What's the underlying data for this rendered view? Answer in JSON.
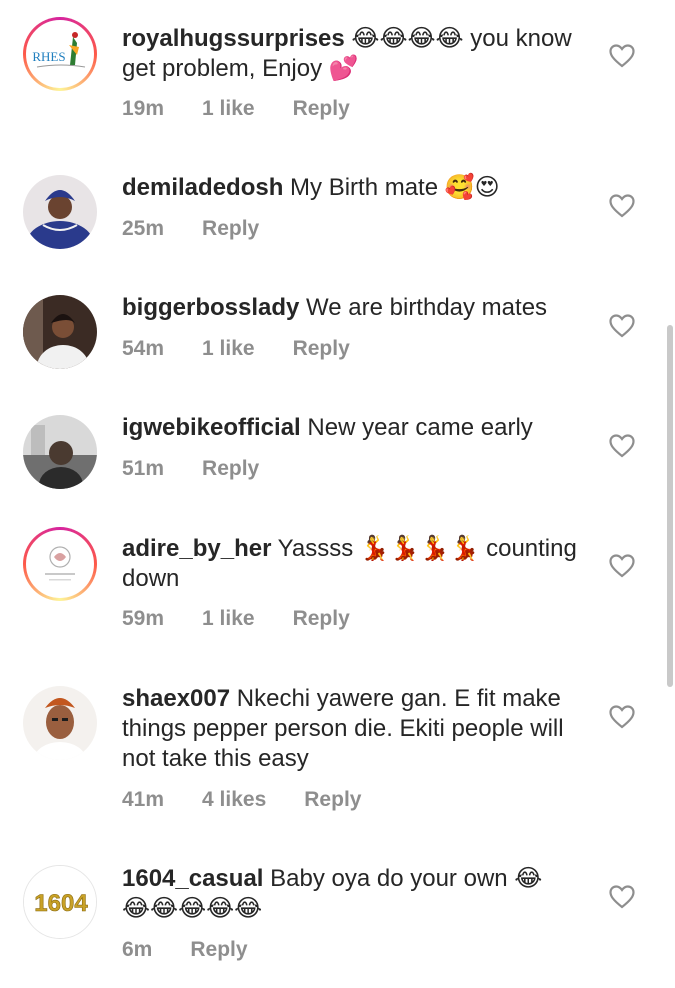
{
  "comments": [
    {
      "username": "royalhugssurprises",
      "text": " 😂😂😂😂 you know get problem, Enjoy 💕",
      "time": "19m",
      "likes": "1 like",
      "reply": "Reply",
      "avatar": {
        "type": "ring",
        "logo_text": "RHES",
        "bg": "#ffffff"
      }
    },
    {
      "username": "demiladedosh",
      "text": " My Birth mate 🥰😍",
      "time": "25m",
      "likes": "",
      "reply": "Reply",
      "avatar": {
        "type": "photo",
        "bg": "#2a3a8c"
      }
    },
    {
      "username": "biggerbosslady",
      "text": " We are birthday mates",
      "time": "54m",
      "likes": "1 like",
      "reply": "Reply",
      "avatar": {
        "type": "photo",
        "bg": "#3b2b24"
      }
    },
    {
      "username": "igwebikeofficial",
      "text": " New year came early",
      "time": "51m",
      "likes": "",
      "reply": "Reply",
      "avatar": {
        "type": "photo",
        "bg": "#6f6f6f"
      }
    },
    {
      "username": "adire_by_her",
      "text": " Yassss 💃💃💃💃 counting down",
      "time": "59m",
      "likes": "1 like",
      "reply": "Reply",
      "avatar": {
        "type": "ring",
        "bg": "#ffffff"
      }
    },
    {
      "username": "shaex007",
      "text": " Nkechi yawere gan. E fit make things pepper person die. Ekiti people will not take this easy",
      "time": "41m",
      "likes": "4 likes",
      "reply": "Reply",
      "avatar": {
        "type": "photo",
        "bg": "#e9e3dc"
      }
    },
    {
      "username": "1604_casual",
      "text": " Baby oya do your own 😂 😂😂😂😂😂",
      "time": "6m",
      "likes": "",
      "reply": "Reply",
      "avatar": {
        "type": "logo",
        "logo_text": "1604",
        "bg": "#ffffff"
      }
    }
  ],
  "colors": {
    "meta_text": "#8e8e8e",
    "body_text": "#262626",
    "heart_stroke": "#8e8e8e"
  },
  "icons": {
    "like": "heart-outline-icon"
  }
}
